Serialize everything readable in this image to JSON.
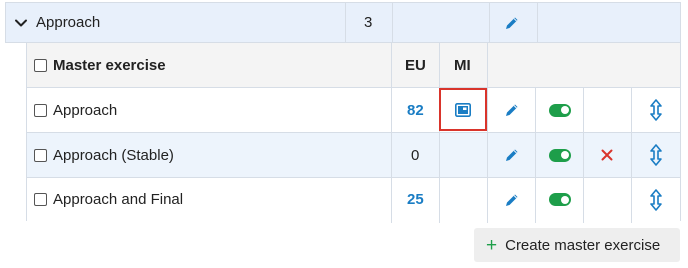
{
  "group": {
    "title": "Approach",
    "count": "3"
  },
  "table": {
    "headers": {
      "name": "Master exercise",
      "eu": "EU",
      "mi": "MI"
    },
    "rows": [
      {
        "name": "Approach",
        "eu": "82",
        "eu_link": true,
        "has_mi_icon": true,
        "has_delete": false
      },
      {
        "name": "Approach (Stable)",
        "eu": "0",
        "eu_link": false,
        "has_mi_icon": false,
        "has_delete": true
      },
      {
        "name": "Approach and Final",
        "eu": "25",
        "eu_link": true,
        "has_mi_icon": false,
        "has_delete": false
      }
    ]
  },
  "create_button": {
    "plus": "+",
    "label": "Create master exercise"
  },
  "colors": {
    "accent_blue": "#1a7dc4",
    "toggle_green": "#1e9e4a",
    "delete_red": "#d9342b",
    "highlight_red": "#d9342b"
  }
}
